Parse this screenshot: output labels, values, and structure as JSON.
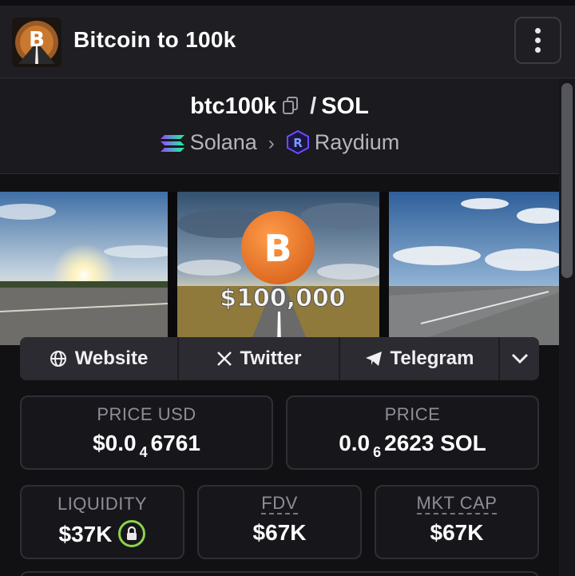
{
  "header": {
    "title": "Bitcoin to 100k",
    "menu_icon": "kebab-menu-icon"
  },
  "pair": {
    "symbol": "btc100k",
    "separator": "/",
    "quote": "SOL",
    "chain": "Solana",
    "dex": "Raydium"
  },
  "banner": {
    "text": "$100,000"
  },
  "socials": {
    "website": "Website",
    "twitter": "Twitter",
    "telegram": "Telegram"
  },
  "stats": {
    "price_usd": {
      "label": "PRICE USD",
      "prefix": "$0.0",
      "sub": "4",
      "suffix": "6761"
    },
    "price": {
      "label": "PRICE",
      "prefix": "0.0",
      "sub": "6",
      "suffix": "2623 SOL"
    },
    "liquidity": {
      "label": "LIQUIDITY",
      "value": "$37K"
    },
    "fdv": {
      "label": "FDV",
      "value": "$67K"
    },
    "mkt_cap": {
      "label": "MKT CAP",
      "value": "$67K"
    }
  },
  "colors": {
    "background": "#1c1c21",
    "accent_orange": "#f08a2a",
    "lock_green": "#8fd14f"
  }
}
